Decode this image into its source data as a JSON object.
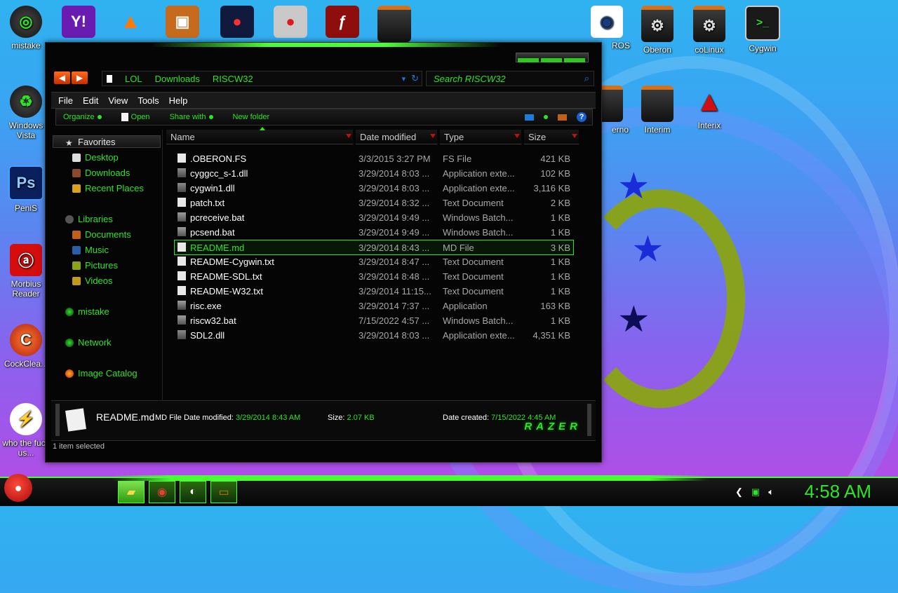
{
  "desktop": {
    "left_icons": [
      {
        "label": "mistake",
        "icon": "green-orb-icon"
      },
      {
        "label": "Windows Vista",
        "icon": "recycle-orb-icon"
      },
      {
        "label": "PeniS",
        "icon": "photoshop-icon"
      },
      {
        "label": "Morbius Reader",
        "icon": "pdf-reader-icon"
      },
      {
        "label": "CockClea...",
        "icon": "cleaner-icon"
      },
      {
        "label": "who the fuck us...",
        "icon": "lightning-icon"
      }
    ],
    "top_icons": [
      "yahoo-icon",
      "vlc-icon",
      "briefcase-icon",
      "angry-birds-space-icon",
      "angry-birds-icon",
      "flash-icon",
      "app-window-icon"
    ],
    "right_icons": [
      {
        "label": "ROS",
        "icon": "eye-icon"
      },
      {
        "label": "Oberon",
        "icon": "gear-window-icon"
      },
      {
        "label": "coLinux",
        "icon": "gear-window-icon"
      },
      {
        "label": "Cygwin",
        "icon": "terminal-icon"
      },
      {
        "label": "erno",
        "icon": "app-window-icon"
      },
      {
        "label": "Interim",
        "icon": "app-window-icon"
      },
      {
        "label": "Interix",
        "icon": "triangle-icon"
      }
    ]
  },
  "window": {
    "address": {
      "crumbs": [
        "LOL",
        "Downloads",
        "RISCW32"
      ]
    },
    "search": {
      "placeholder": "Search RISCW32"
    },
    "menu": [
      "File",
      "Edit",
      "View",
      "Tools",
      "Help"
    ],
    "toolbar": {
      "organize": "Organize",
      "open": "Open",
      "share": "Share with",
      "new_folder": "New folder"
    },
    "nav": {
      "favorites": "Favorites",
      "desktop": "Desktop",
      "downloads": "Downloads",
      "recent": "Recent Places",
      "libraries": "Libraries",
      "documents": "Documents",
      "music": "Music",
      "pictures": "Pictures",
      "videos": "Videos",
      "homegroup": "mistake",
      "network": "Network",
      "image_catalog": "Image Catalog"
    },
    "columns": {
      "name": "Name",
      "date": "Date modified",
      "type": "Type",
      "size": "Size"
    },
    "files": [
      {
        "name": ".OBERON.FS",
        "date": "3/3/2015 3:27 PM",
        "type": "FS File",
        "size": "421 KB",
        "icon": "file-icon"
      },
      {
        "name": "cyggcc_s-1.dll",
        "date": "3/29/2014 8:03 ...",
        "type": "Application exte...",
        "size": "102 KB",
        "icon": "dll-icon"
      },
      {
        "name": "cygwin1.dll",
        "date": "3/29/2014 8:03 ...",
        "type": "Application exte...",
        "size": "3,116 KB",
        "icon": "dll-icon"
      },
      {
        "name": "patch.txt",
        "date": "3/29/2014 8:32 ...",
        "type": "Text Document",
        "size": "2 KB",
        "icon": "file-icon"
      },
      {
        "name": "pcreceive.bat",
        "date": "3/29/2014 9:49 ...",
        "type": "Windows Batch...",
        "size": "1 KB",
        "icon": "batch-icon"
      },
      {
        "name": "pcsend.bat",
        "date": "3/29/2014 9:49 ...",
        "type": "Windows Batch...",
        "size": "1 KB",
        "icon": "batch-icon"
      },
      {
        "name": "README.md",
        "date": "3/29/2014 8:43 ...",
        "type": "MD File",
        "size": "3 KB",
        "icon": "file-icon"
      },
      {
        "name": "README-Cygwin.txt",
        "date": "3/29/2014 8:47 ...",
        "type": "Text Document",
        "size": "1 KB",
        "icon": "file-icon"
      },
      {
        "name": "README-SDL.txt",
        "date": "3/29/2014 8:48 ...",
        "type": "Text Document",
        "size": "1 KB",
        "icon": "file-icon"
      },
      {
        "name": "README-W32.txt",
        "date": "3/29/2014 11:15...",
        "type": "Text Document",
        "size": "1 KB",
        "icon": "file-icon"
      },
      {
        "name": "risc.exe",
        "date": "3/29/2014 7:37 ...",
        "type": "Application",
        "size": "163 KB",
        "icon": "exe-icon"
      },
      {
        "name": "riscw32.bat",
        "date": "7/15/2022 4:57 ...",
        "type": "Windows Batch...",
        "size": "1 KB",
        "icon": "batch-icon"
      },
      {
        "name": "SDL2.dll",
        "date": "3/29/2014 8:03 ...",
        "type": "Application exte...",
        "size": "4,351 KB",
        "icon": "dll-icon"
      }
    ],
    "selected_index": 6,
    "details": {
      "name": "README.md",
      "type_label": "MD File",
      "date_mod_label": "Date modified:",
      "date_mod": "3/29/2014 8:43 AM",
      "size_label": "Size:",
      "size": "2.07 KB",
      "created_label": "Date created:",
      "created": "7/15/2022 4:45 AM",
      "brand": "RAZER"
    },
    "status": "1 item selected"
  },
  "taskbar": {
    "clock": "4:58 AM",
    "apps": [
      "explorer-icon",
      "chrome-icon",
      "edge-icon",
      "window-app-icon"
    ],
    "tray": [
      "back-icon",
      "battery-icon",
      "volume-icon"
    ]
  },
  "colors": {
    "accent": "#2ee328",
    "orange": "#ff6a1a"
  }
}
